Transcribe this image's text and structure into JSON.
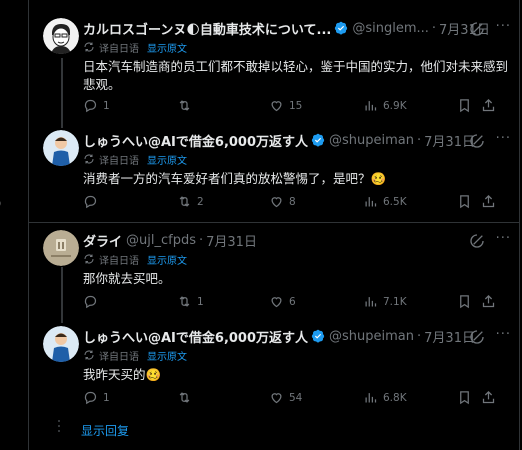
{
  "tweets": [
    {
      "name": "カルロスゴーンヌ🌓自動車技术について...",
      "handle": "@singlem...",
      "date": "7月31日",
      "translated_by": "译自日语",
      "show_original": "显示原文",
      "text": "日本汽车制造商的员工们都不敢掉以轻心，鉴于中国的实力，他们对未来感到悲观。",
      "replies": "1",
      "retweets": "",
      "likes": "15",
      "views": "6.9K"
    },
    {
      "name": "しゅうへい@AIで借金6,000万返す人",
      "handle": "@shupeiman",
      "date": "7月31日",
      "translated_by": "译自日语",
      "show_original": "显示原文",
      "text": "消费者一方的汽车爱好者们真的放松警惕了，是吧？🥴",
      "replies": "",
      "retweets": "2",
      "likes": "8",
      "views": "6.5K"
    },
    {
      "name": "ダライ",
      "handle": "@ujl_cfpds",
      "date": "7月31日",
      "translated_by": "译自日语",
      "show_original": "显示原文",
      "text": "那你就去买吧。",
      "replies": "",
      "retweets": "1",
      "likes": "6",
      "views": "7.1K"
    },
    {
      "name": "しゅうへい@AIで借金6,000万返す人",
      "handle": "@shupeiman",
      "date": "7月31日",
      "translated_by": "译自日语",
      "show_original": "显示原文",
      "text": "我昨天买的🥴",
      "replies": "1",
      "retweets": "",
      "likes": "54",
      "views": "6.8K"
    }
  ],
  "show_replies": "显示回复",
  "more_glyph": "···",
  "edge_glyph": ")",
  "colors": {
    "background": "#000000",
    "text": "#e7e9ea",
    "muted": "#71767b",
    "accent": "#1d9bf0",
    "border": "#2f3336"
  }
}
